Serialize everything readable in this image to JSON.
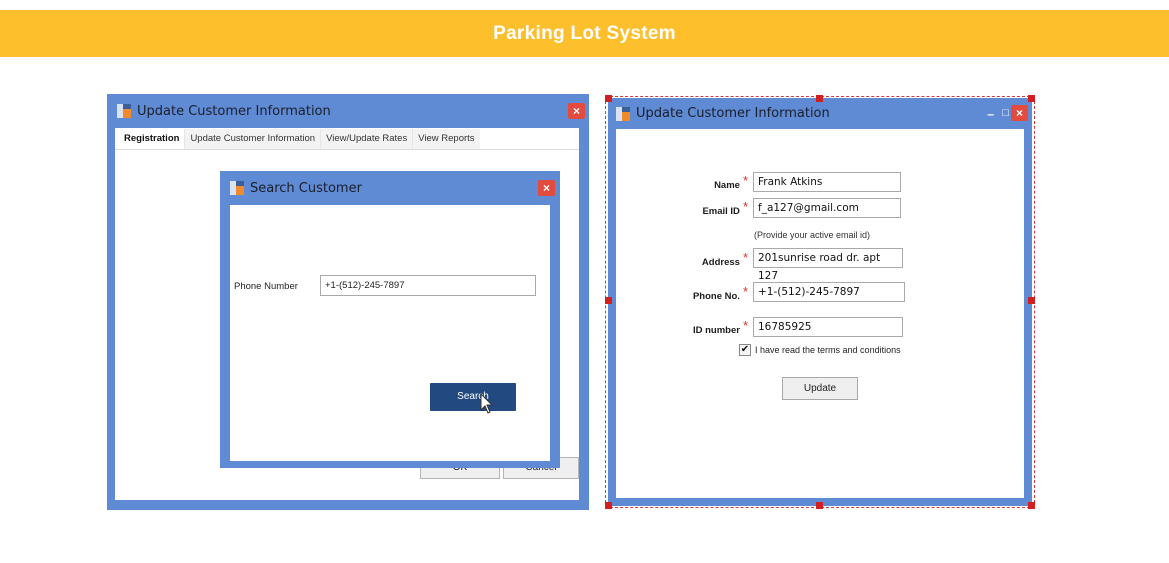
{
  "header": {
    "title": "Parking Lot System"
  },
  "left_window": {
    "title": "Update Customer Information",
    "tabs": [
      {
        "label": "Registration",
        "active": true
      },
      {
        "label": "Update Customer Information",
        "active": false
      },
      {
        "label": "View/Update Rates",
        "active": false
      },
      {
        "label": "View Reports",
        "active": false
      }
    ],
    "ok_label": "OK",
    "cancel_label": "Cancel"
  },
  "search_dialog": {
    "title": "Search Customer",
    "phone_label": "Phone Number",
    "phone_value": "+1-(512)-245-7897",
    "search_label": "Search"
  },
  "right_window": {
    "title": "Update Customer Information",
    "fields": {
      "name": {
        "label": "Name",
        "value": "Frank Atkins"
      },
      "email": {
        "label": "Email ID",
        "value": "f_a127@gmail.com",
        "hint": "(Provide your active email id)"
      },
      "address": {
        "label": "Address",
        "value": "201sunrise road dr. apt 127"
      },
      "phone": {
        "label": "Phone No.",
        "value": "+1-(512)-245-7897"
      },
      "id_number": {
        "label": "ID number",
        "value": "16785925"
      }
    },
    "required_marker": "*",
    "terms_label": "I have read the terms and conditions",
    "terms_checked": true,
    "update_label": "Update"
  },
  "icons": {
    "close": "×",
    "minimize": "–",
    "maximize": "□",
    "check": "✔"
  },
  "colors": {
    "header_bg": "#fdbf2c",
    "window_frame": "#5f8ad4",
    "close_button": "#e34b3e",
    "primary_button": "#224a80",
    "required_marker": "#e0312a",
    "selection_handles": "#d21f1f"
  }
}
